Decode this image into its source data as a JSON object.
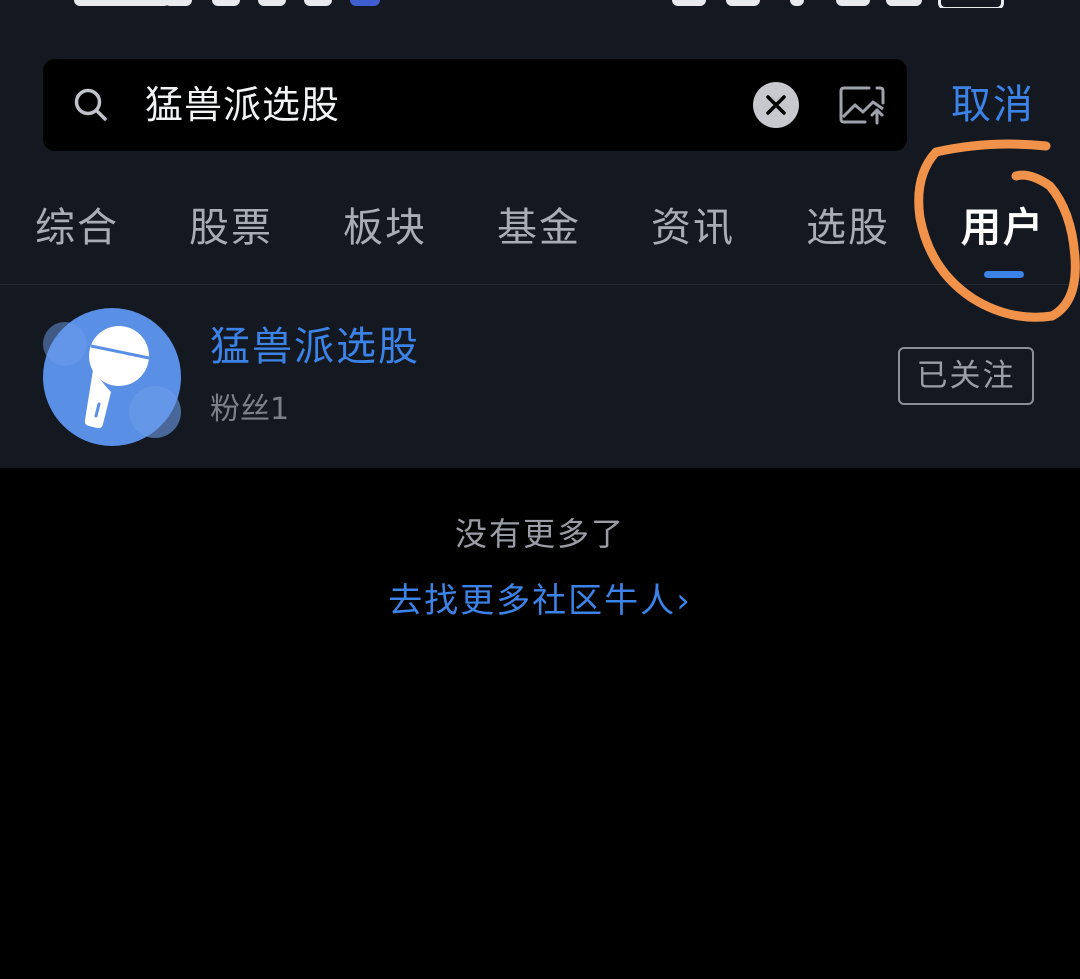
{
  "search": {
    "query": "猛兽派选股",
    "cancel_label": "取消"
  },
  "tabs": [
    {
      "label": "综合"
    },
    {
      "label": "股票"
    },
    {
      "label": "板块"
    },
    {
      "label": "基金"
    },
    {
      "label": "资讯"
    },
    {
      "label": "选股"
    },
    {
      "label": "用户",
      "active": true
    }
  ],
  "results": [
    {
      "name": "猛兽派选股",
      "fans": "粉丝1",
      "follow_label": "已关注",
      "avatar_icon": "flashlight-icon"
    }
  ],
  "footer": {
    "no_more": "没有更多了",
    "find_more": "去找更多社区牛人",
    "find_more_chevron": "›"
  },
  "colors": {
    "accent": "#3c83e8",
    "annotation": "#f0924a",
    "panel_bg": "#141821",
    "page_bg": "#000000"
  }
}
